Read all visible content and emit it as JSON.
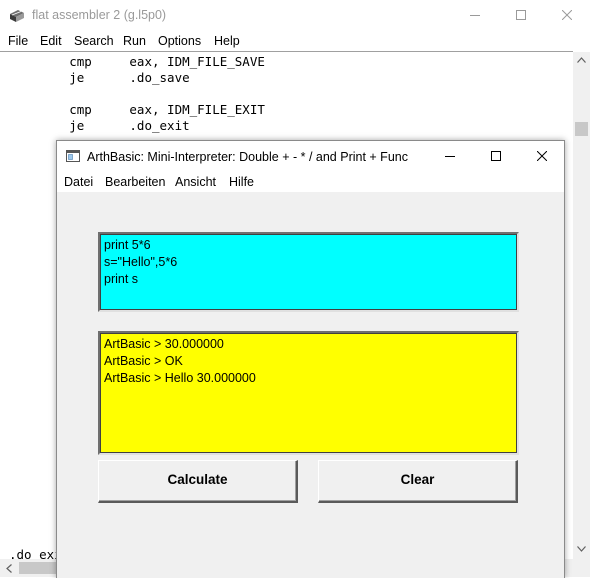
{
  "outer_window": {
    "title": "flat assembler 2 (g.l5p0)",
    "menu": [
      "File",
      "Edit",
      "Search",
      "Run",
      "Options",
      "Help"
    ],
    "code_lines": [
      "        cmp     eax, IDM_FILE_SAVE",
      "        je      .do_save",
      "",
      "        cmp     eax, IDM_FILE_EXIT",
      "        je      .do_exit"
    ],
    "bottom_code_line": ".do_exi"
  },
  "dialog": {
    "title": "ArthBasic: Mini-Interpreter: Double + - * / and Print + Func",
    "menu": [
      "Datei",
      "Bearbeiten",
      "Ansicht",
      "Hilfe"
    ],
    "input_lines": [
      "print 5*6",
      "s=\"Hello\",5*6",
      "print s"
    ],
    "output_lines": [
      "ArtBasic > 30.000000",
      "ArtBasic > OK",
      "ArtBasic > Hello 30.000000"
    ],
    "calculate_label": "Calculate",
    "clear_label": "Clear"
  },
  "colors": {
    "input_bg": "#00ffff",
    "output_bg": "#ffff00",
    "dialog_bg": "#f0f0f0"
  },
  "icons": [
    "app-books-icon",
    "minimize-icon",
    "maximize-icon",
    "close-icon",
    "scroll-up-arrow-icon",
    "scroll-down-arrow-icon",
    "scroll-left-arrow-icon",
    "scroll-right-arrow-icon"
  ]
}
